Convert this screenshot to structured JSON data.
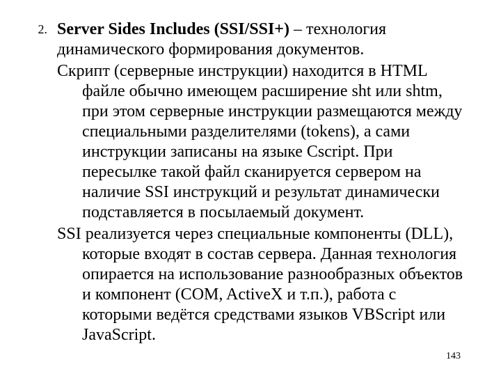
{
  "list": {
    "marker": "2.",
    "item": {
      "title": "Server Sides Includes (SSI/SSI+)",
      "rest": " – технология динамического формирования документов."
    }
  },
  "para1": "Скрипт (серверные инструкции) находится в HTML файле обычно имеющем расширение sht или shtm, при этом серверные инструкции размещаются между специальными разделителями (tokens), а сами инструкции записаны на языке Cscript. При пересылке такой файл сканируется сервером на наличие SSI инструкций и результат динамически подставляется в посылаемый документ.",
  "para2": "SSI реализуется через специальные компоненты (DLL), которые входят в состав сервера. Данная технология опирается на использование разнообразных объектов и компонент (COM, ActiveX и т.п.), работа с которыми ведётся средствами языков VBScript или JavaScript.",
  "page_number": "143"
}
